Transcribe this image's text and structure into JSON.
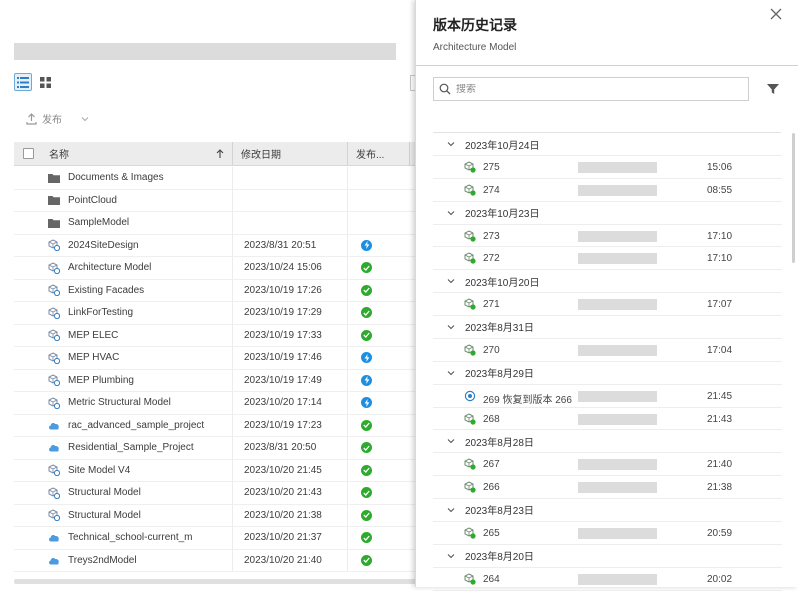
{
  "toolbar": {
    "publish_label": "发布"
  },
  "table": {
    "headers": {
      "name": "名称",
      "date": "修改日期",
      "status": "发布..."
    },
    "rows": [
      {
        "name": "Documents & Images",
        "type": "folder",
        "date": "",
        "status": ""
      },
      {
        "name": "PointCloud",
        "type": "folder",
        "date": "",
        "status": ""
      },
      {
        "name": "SampleModel",
        "type": "folder",
        "date": "",
        "status": ""
      },
      {
        "name": "2024SiteDesign",
        "type": "model",
        "date": "2023/8/31 20:51",
        "status": "publishing"
      },
      {
        "name": "Architecture Model",
        "type": "model",
        "date": "2023/10/24 15:06",
        "status": "ok"
      },
      {
        "name": "Existing Facades",
        "type": "model",
        "date": "2023/10/19 17:26",
        "status": "ok"
      },
      {
        "name": "LinkForTesting",
        "type": "model",
        "date": "2023/10/19 17:29",
        "status": "ok"
      },
      {
        "name": "MEP ELEC",
        "type": "model",
        "date": "2023/10/19 17:33",
        "status": "ok"
      },
      {
        "name": "MEP HVAC",
        "type": "model",
        "date": "2023/10/19 17:46",
        "status": "publishing"
      },
      {
        "name": "MEP Plumbing",
        "type": "model",
        "date": "2023/10/19 17:49",
        "status": "publishing"
      },
      {
        "name": "Metric Structural Model",
        "type": "model",
        "date": "2023/10/20 17:14",
        "status": "publishing"
      },
      {
        "name": "rac_advanced_sample_project",
        "type": "cloud",
        "date": "2023/10/19 17:23",
        "status": "ok"
      },
      {
        "name": "Residential_Sample_Project",
        "type": "cloud",
        "date": "2023/8/31 20:50",
        "status": "ok"
      },
      {
        "name": "Site Model V4",
        "type": "model",
        "date": "2023/10/20 21:45",
        "status": "ok"
      },
      {
        "name": "Structural Model",
        "type": "model",
        "date": "2023/10/20 21:43",
        "status": "ok"
      },
      {
        "name": "Structural Model",
        "type": "model",
        "date": "2023/10/20 21:38",
        "status": "ok"
      },
      {
        "name": "Technical_school-current_m",
        "type": "cloud",
        "date": "2023/10/20 21:37",
        "status": "ok"
      },
      {
        "name": "Treys2ndModel",
        "type": "cloud",
        "date": "2023/10/20 21:40",
        "status": "ok"
      }
    ]
  },
  "panel": {
    "title": "版本历史记录",
    "subtitle": "Architecture Model",
    "search_placeholder": "搜索",
    "groups": [
      {
        "date": "2023年10月24日",
        "versions": [
          {
            "num": "275",
            "time": "15:06",
            "icon": "model"
          },
          {
            "num": "274",
            "time": "08:55",
            "icon": "model"
          }
        ]
      },
      {
        "date": "2023年10月23日",
        "versions": [
          {
            "num": "273",
            "time": "17:10",
            "icon": "model"
          },
          {
            "num": "272",
            "time": "17:10",
            "icon": "model"
          }
        ]
      },
      {
        "date": "2023年10月20日",
        "versions": [
          {
            "num": "271",
            "time": "17:07",
            "icon": "model"
          }
        ]
      },
      {
        "date": "2023年8月31日",
        "versions": [
          {
            "num": "270",
            "time": "17:04",
            "icon": "model"
          }
        ]
      },
      {
        "date": "2023年8月29日",
        "versions": [
          {
            "num": "269 恢复到版本 266",
            "time": "21:45",
            "icon": "restore"
          },
          {
            "num": "268",
            "time": "21:43",
            "icon": "model"
          }
        ]
      },
      {
        "date": "2023年8月28日",
        "versions": [
          {
            "num": "267",
            "time": "21:40",
            "icon": "model"
          },
          {
            "num": "266",
            "time": "21:38",
            "icon": "model"
          }
        ]
      },
      {
        "date": "2023年8月23日",
        "versions": [
          {
            "num": "265",
            "time": "20:59",
            "icon": "model"
          }
        ]
      },
      {
        "date": "2023年8月20日",
        "versions": [
          {
            "num": "264",
            "time": "20:02",
            "icon": "model"
          }
        ]
      }
    ]
  },
  "colors": {
    "status_ok": "#2eaa2e",
    "status_publishing": "#1d8fe0",
    "accent": "#1d8fe0"
  }
}
